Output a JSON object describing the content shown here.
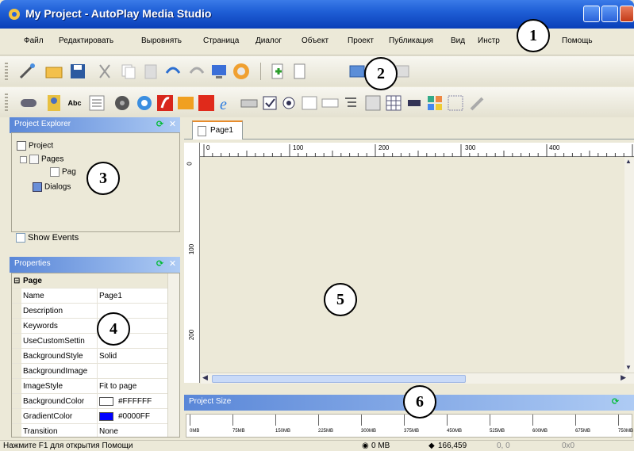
{
  "window": {
    "title": "My Project - AutoPlay Media Studio"
  },
  "menu": {
    "items": [
      "Файл",
      "Редактировать",
      "Выровнять",
      "Страница",
      "Диалог",
      "Объект",
      "Проект",
      "Публикация",
      "Вид",
      "Инстр",
      "Помощь"
    ]
  },
  "explorer": {
    "title": "Project Explorer",
    "tree": [
      "Project",
      "Pages",
      "Pag",
      "Dialogs"
    ],
    "show_events_label": "Show Events"
  },
  "properties": {
    "title": "Properties",
    "section": "Page",
    "rows": [
      {
        "name": "Name",
        "value": "Page1"
      },
      {
        "name": "Description",
        "value": ""
      },
      {
        "name": "Keywords",
        "value": ""
      },
      {
        "name": "UseCustomSettin",
        "value": ""
      },
      {
        "name": "BackgroundStyle",
        "value": "Solid"
      },
      {
        "name": "BackgroundImage",
        "value": ""
      },
      {
        "name": "ImageStyle",
        "value": "Fit to page"
      },
      {
        "name": "BackgroundColor",
        "value": "#FFFFFF"
      },
      {
        "name": "GradientColor",
        "value": "#0000FF"
      },
      {
        "name": "Transition",
        "value": "None"
      }
    ],
    "colors": {
      "background": "#FFFFFF",
      "gradient": "#0000FF"
    }
  },
  "document": {
    "tab": "Page1",
    "hruler": [
      "0",
      "100",
      "200",
      "300",
      "400"
    ],
    "vruler": [
      "0",
      "100",
      "200"
    ]
  },
  "project_size": {
    "title": "Project Size",
    "ticks": [
      "0MB",
      "75MB",
      "150MB",
      "225MB",
      "300MB",
      "375MB",
      "450MB",
      "525MB",
      "600MB",
      "675MB",
      "750MB"
    ]
  },
  "status": {
    "hint": "Нажмите F1 для открытия Помощи",
    "size": "0 MB",
    "count": "166,459",
    "pos": "0, 0",
    "dims": "0x0"
  },
  "callouts": [
    "1",
    "2",
    "3",
    "4",
    "5",
    "6"
  ]
}
